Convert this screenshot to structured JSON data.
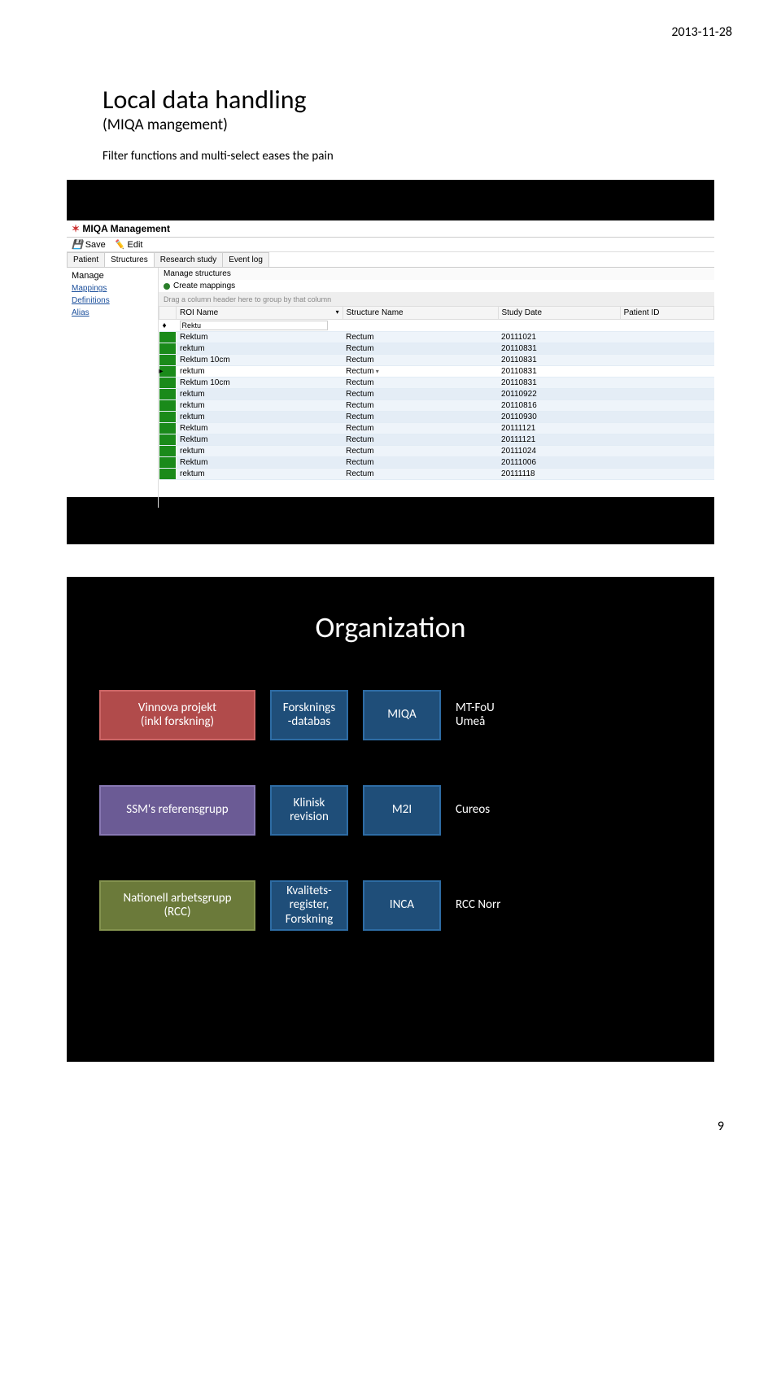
{
  "page": {
    "date": "2013-11-28",
    "number": "9"
  },
  "slide1": {
    "title": "Local data handling",
    "subtitle": "(MIQA mangement)",
    "filter_text": "Filter functions and multi-select eases the pain",
    "window_title": "MIQA Management",
    "toolbar": {
      "save": "Save",
      "edit": "Edit"
    },
    "tabs": [
      "Patient",
      "Structures",
      "Research study",
      "Event log"
    ],
    "side_title": "Manage",
    "side_links": [
      "Mappings",
      "Definitions",
      "Alias"
    ],
    "panel_title": "Manage structures",
    "create_label": "Create mappings",
    "group_hint": "Drag a column header here to group by that column",
    "columns": [
      "",
      "ROI Name",
      "Structure Name",
      "Study Date",
      "Patient ID"
    ],
    "filter_value": "Rektu",
    "rows": [
      {
        "roi": "Rektum",
        "sn": "Rectum",
        "sd": "20111021",
        "pid": ""
      },
      {
        "roi": "rektum",
        "sn": "Rectum",
        "sd": "20110831",
        "pid": ""
      },
      {
        "roi": "Rektum 10cm",
        "sn": "Rectum",
        "sd": "20110831",
        "pid": ""
      },
      {
        "roi": "rektum",
        "sn": "Rectum",
        "sd": "20110831",
        "pid": "",
        "sel": true
      },
      {
        "roi": "Rektum 10cm",
        "sn": "Rectum",
        "sd": "20110831",
        "pid": ""
      },
      {
        "roi": "rektum",
        "sn": "Rectum",
        "sd": "20110922",
        "pid": ""
      },
      {
        "roi": "rektum",
        "sn": "Rectum",
        "sd": "20110816",
        "pid": ""
      },
      {
        "roi": "rektum",
        "sn": "Rectum",
        "sd": "20110930",
        "pid": ""
      },
      {
        "roi": "Rektum",
        "sn": "Rectum",
        "sd": "20111121",
        "pid": ""
      },
      {
        "roi": "Rektum",
        "sn": "Rectum",
        "sd": "20111121",
        "pid": ""
      },
      {
        "roi": "rektum",
        "sn": "Rectum",
        "sd": "20111024",
        "pid": ""
      },
      {
        "roi": "Rektum",
        "sn": "Rectum",
        "sd": "20111006",
        "pid": ""
      },
      {
        "roi": "rektum",
        "sn": "Rectum",
        "sd": "20111118",
        "pid": ""
      }
    ]
  },
  "slide2": {
    "title": "Organization",
    "rows": [
      [
        {
          "label": "Vinnova projekt\n(inkl forskning)",
          "cls": "red wide"
        },
        {
          "label": "Forsknings\n-databas",
          "cls": "navy narrow"
        },
        {
          "label": "MIQA",
          "cls": "navy narrow"
        },
        {
          "label": "MT-FoU\nUmeå",
          "cls": "text-only"
        }
      ],
      [
        {
          "label": "SSM's referensgrupp",
          "cls": "purple wide"
        },
        {
          "label": "Klinisk\nrevision",
          "cls": "navy narrow"
        },
        {
          "label": "M2I",
          "cls": "navy narrow"
        },
        {
          "label": "Cureos",
          "cls": "text-only"
        }
      ],
      [
        {
          "label": "Nationell arbetsgrupp\n(RCC)",
          "cls": "olive wide"
        },
        {
          "label": "Kvalitets-\nregister,\nForskning",
          "cls": "navy narrow"
        },
        {
          "label": "INCA",
          "cls": "navy narrow"
        },
        {
          "label": "RCC Norr",
          "cls": "text-only"
        }
      ]
    ]
  }
}
